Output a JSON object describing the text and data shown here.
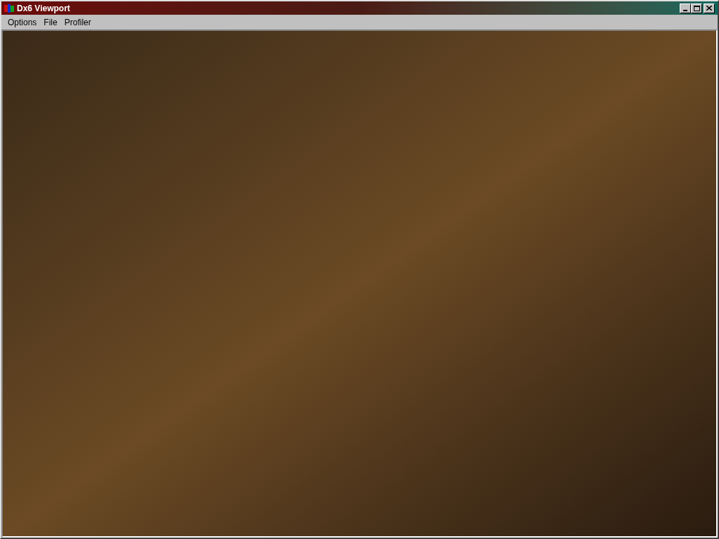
{
  "window": {
    "title": "Dx6 Viewport"
  },
  "menu": [
    "Options",
    "File",
    "Profiler"
  ]
}
